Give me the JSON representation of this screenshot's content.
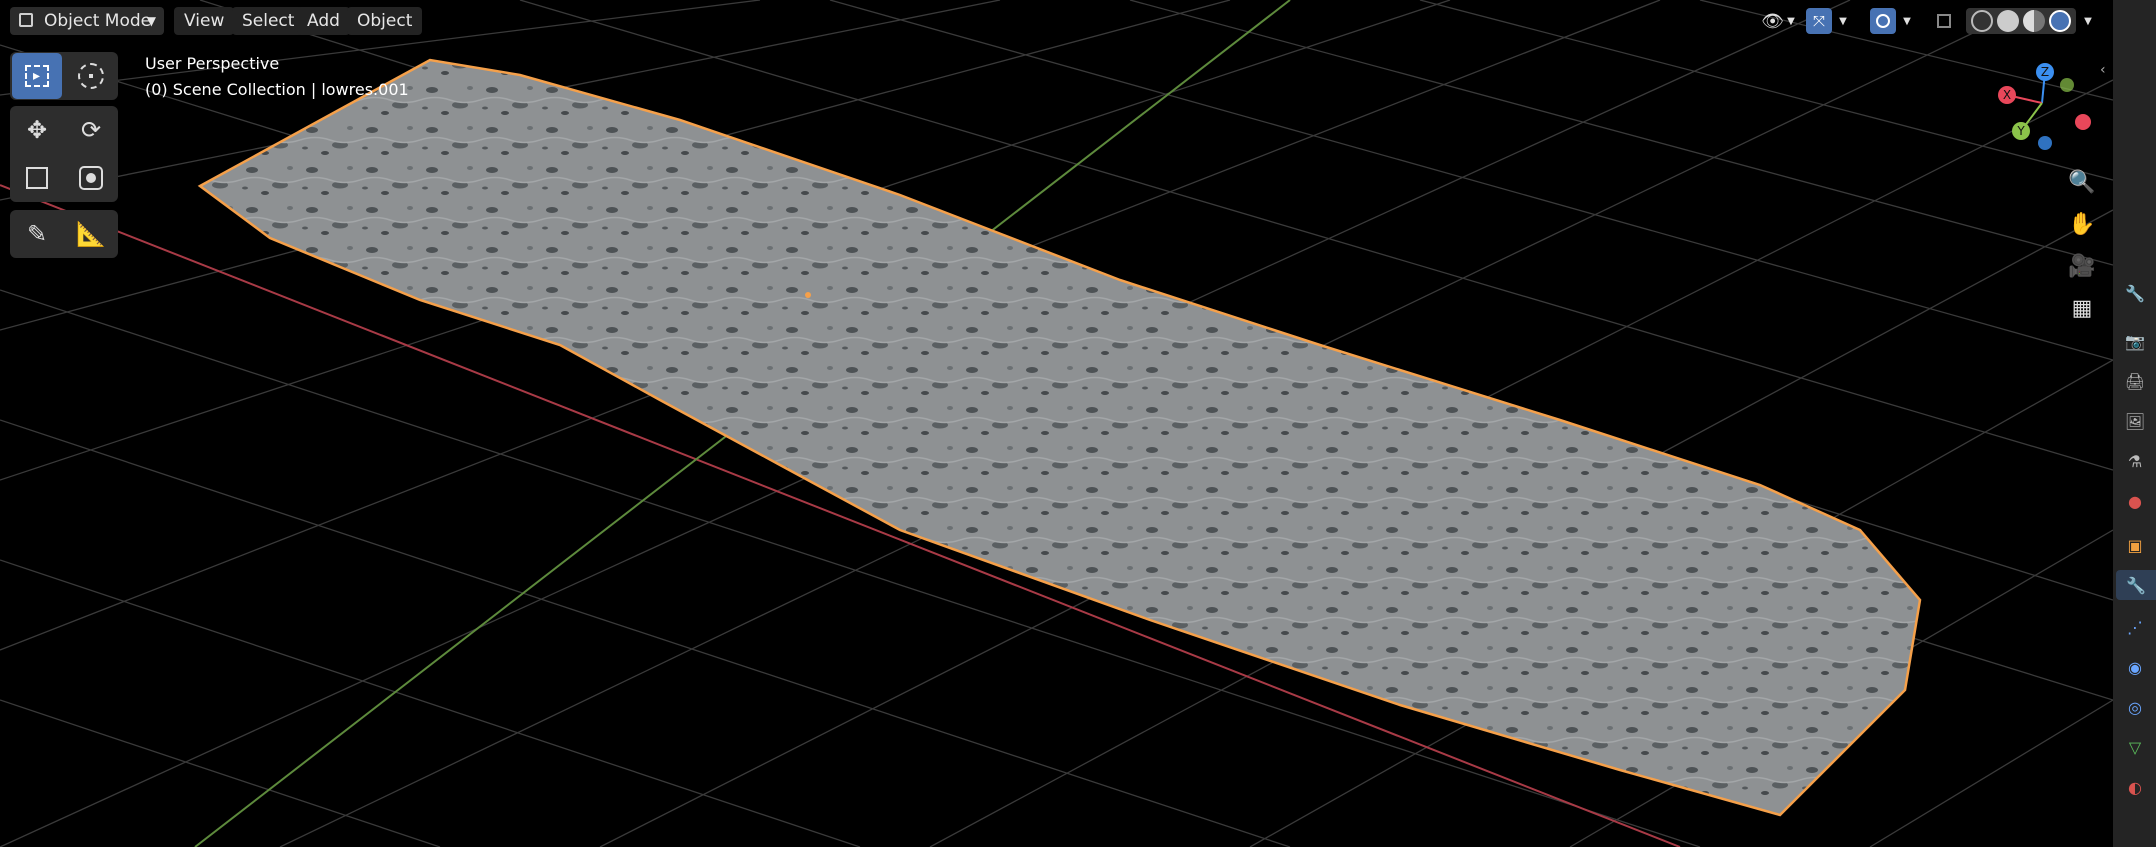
{
  "header": {
    "mode_label": "Object Mode",
    "menus": [
      "View",
      "Select",
      "Add",
      "Object"
    ]
  },
  "overlay": {
    "view_name": "User Perspective",
    "collection_info": "(0) Scene Collection | lowres.001"
  },
  "toolbar": {
    "tools": [
      "select-box",
      "cursor",
      "move",
      "rotate",
      "scale",
      "transform",
      "annotate",
      "measure"
    ],
    "active_tool": "select-box"
  },
  "gizmo": {
    "axis_x": "X",
    "axis_y": "Y",
    "axis_z": "Z"
  },
  "nav_controls": [
    "zoom",
    "pan",
    "camera-view",
    "ortho-toggle"
  ],
  "colors": {
    "accent": "#4772b3",
    "x_axis": "#e8475a",
    "y_axis": "#8bc34a",
    "z_axis": "#3b8ff0",
    "selection_outline": "#f5a04a",
    "mesh_surface": "#8c8f91",
    "grid": "#3a3a3a"
  }
}
